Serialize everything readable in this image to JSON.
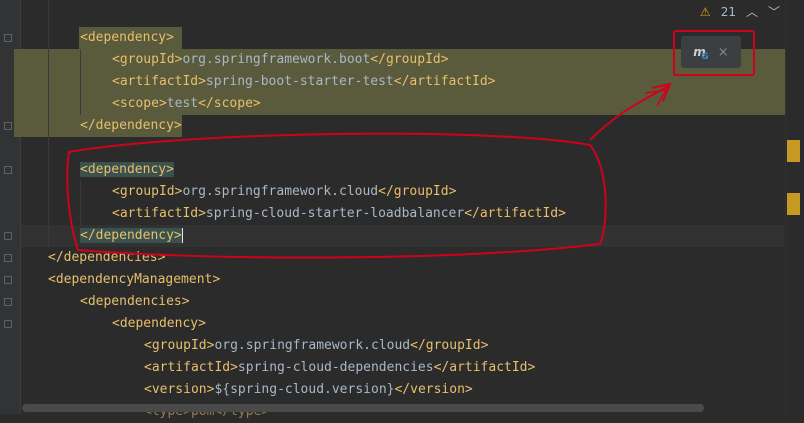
{
  "toolbar": {
    "warning_count": "21",
    "warning_icon": "warning-icon",
    "up_icon": "chevron-up-icon",
    "down_icon": "chevron-down-icon"
  },
  "popup": {
    "maven_icon": "maven-load-changes-icon",
    "maven_letter": "m",
    "maven_sub": "G",
    "close_label": "×"
  },
  "code": [
    {
      "t": "<dependency>",
      "open": "<",
      "name": "dependency",
      "close": ">"
    },
    {
      "open": "<groupId>",
      "value": "org.springframework.boot",
      "close": "</groupId>"
    },
    {
      "open": "<artifactId>",
      "value": "spring-boot-starter-test",
      "close": "</artifactId>"
    },
    {
      "open": "<scope>",
      "value": "test",
      "close": "</scope>"
    },
    {
      "text": "</dependency>"
    },
    {
      "text": "<dependency>"
    },
    {
      "open": "<groupId>",
      "value": "org.springframework.cloud",
      "close": "</groupId>"
    },
    {
      "open": "<artifactId>",
      "value": "spring-cloud-starter-loadbalancer",
      "close": "</artifactId>"
    },
    {
      "text": "</dependency>"
    },
    {
      "text": "</dependencies>"
    },
    {
      "text": "<dependencyManagement>"
    },
    {
      "text": "<dependencies>"
    },
    {
      "text": "<dependency>"
    },
    {
      "open": "<groupId>",
      "value": "org.springframework.cloud",
      "close": "</groupId>"
    },
    {
      "open": "<artifactId>",
      "value": "spring-cloud-dependencies",
      "close": "</artifactId>"
    },
    {
      "open": "<version>",
      "value": "${spring-cloud.version}",
      "close": "</version>"
    },
    {
      "text": "<type>pom</type>"
    }
  ],
  "colors": {
    "background": "#2b2b2b",
    "tag": "#e8bf6a",
    "text": "#a9b7c6",
    "highlight": "#5a5a3c",
    "annotation": "#d0021b"
  }
}
